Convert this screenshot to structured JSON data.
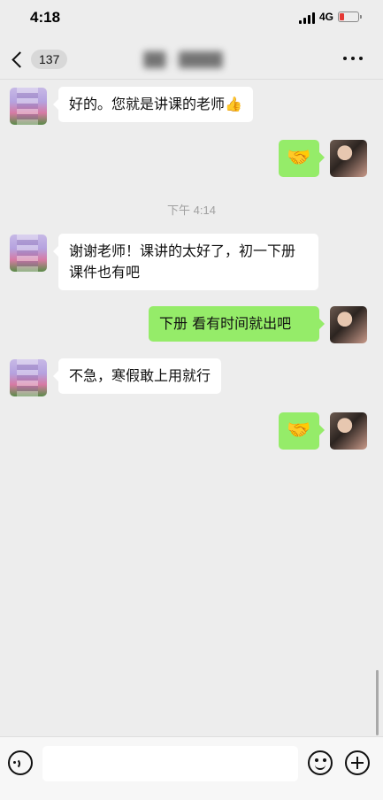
{
  "status_bar": {
    "time": "4:18",
    "network": "4G",
    "battery_level": 0.2,
    "battery_color": "#e53935"
  },
  "nav": {
    "unread_count": "137",
    "title": "██ · ████",
    "more_icon": "ellipsis-icon",
    "back_icon": "chevron-left-icon"
  },
  "messages": [
    {
      "side": "left",
      "text": "好的。您就是讲课的老师👍"
    },
    {
      "side": "right",
      "text": "🤝"
    },
    {
      "side": "left",
      "text": "谢谢老师！课讲的太好了，初一下册课件也有吧"
    },
    {
      "side": "right",
      "text": "下册 看有时间就出吧"
    },
    {
      "side": "left",
      "text": "不急，寒假敢上用就行"
    },
    {
      "side": "right",
      "text": "🤝"
    }
  ],
  "timestamp": "下午 4:14",
  "input_bar": {
    "voice_icon": "voice-icon",
    "emoji_icon": "emoji-icon",
    "plus_icon": "plus-icon",
    "placeholder": ""
  },
  "colors": {
    "background": "#ededed",
    "bubble_self": "#95ec69",
    "bubble_other": "#ffffff"
  }
}
